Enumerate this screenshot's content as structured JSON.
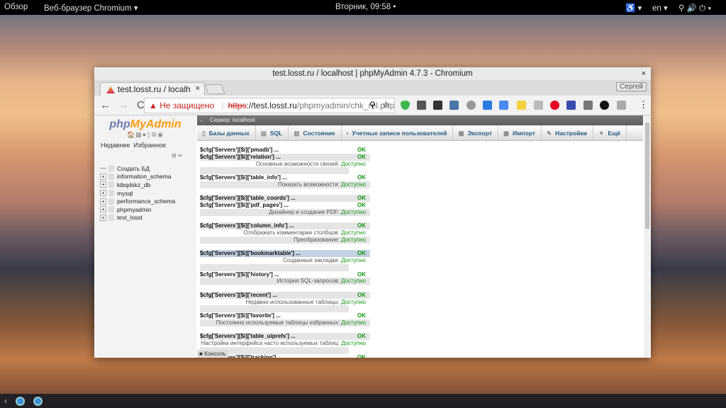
{
  "topbar": {
    "overview": "Обзор",
    "app": "Веб-браузер Chromium ▾",
    "clock": "Вторник, 09:58 •",
    "lang": "en ▾"
  },
  "window": {
    "title": "test.losst.ru / localhost | phpMyAdmin 4.7.3 - Chromium",
    "close": "×"
  },
  "tab": {
    "label": "test.losst.ru / localh",
    "close": "×"
  },
  "profile": "Сергей",
  "address": {
    "warning": "▲ Не защищено",
    "scheme": "https",
    "host": "://test.losst.ru",
    "path": "/phpmyadmin/chk_rel.php?c"
  },
  "sidebar": {
    "logo_a": "php",
    "logo_b": "MyAdmin",
    "recent": "Недавнее",
    "favorites": "Избранное",
    "new_db": "Создать БД",
    "dbs": [
      "information_schema",
      "kibqdskz_db",
      "mysql",
      "performance_schema",
      "phpmyadmin",
      "test_losst"
    ]
  },
  "server": "Сервер: localhost",
  "menu": [
    "Базы данных",
    "SQL",
    "Состояние",
    "Учетные записи пользователей",
    "Экспорт",
    "Импорт",
    "Настройки",
    "Ещё"
  ],
  "rows": [
    {
      "t": "cfg",
      "label": "$cfg['Servers'][$i]['pmadb'] ...",
      "status": "OK"
    },
    {
      "t": "cfg",
      "label": "$cfg['Servers'][$i]['relation'] ...",
      "status": "OK"
    },
    {
      "t": "feat",
      "label": "Основные возможности связей:",
      "status": "Доступно"
    },
    {
      "t": "empty"
    },
    {
      "t": "cfg",
      "label": "$cfg['Servers'][$i]['table_info'] ...",
      "status": "OK"
    },
    {
      "t": "feat",
      "label": "Показать возможности:",
      "status": "Доступно"
    },
    {
      "t": "empty"
    },
    {
      "t": "cfg",
      "label": "$cfg['Servers'][$i]['table_coords'] ...",
      "status": "OK"
    },
    {
      "t": "cfg",
      "label": "$cfg['Servers'][$i]['pdf_pages'] ...",
      "status": "OK"
    },
    {
      "t": "feat",
      "label": "Дизайнер и создание PDF:",
      "status": "Доступно"
    },
    {
      "t": "empty"
    },
    {
      "t": "cfg",
      "label": "$cfg['Servers'][$i]['column_info'] ...",
      "status": "OK"
    },
    {
      "t": "feat",
      "label": "Отображать комментарии столбцов:",
      "status": "Доступно"
    },
    {
      "t": "feat",
      "label": "Преобразование:",
      "status": "Доступно"
    },
    {
      "t": "empty"
    },
    {
      "t": "cfg",
      "label": "$cfg['Servers'][$i]['bookmarktable'] ...",
      "status": "OK",
      "hl": true
    },
    {
      "t": "feat",
      "label": "Созданные закладки:",
      "status": "Доступно"
    },
    {
      "t": "empty"
    },
    {
      "t": "cfg",
      "label": "$cfg['Servers'][$i]['history'] ...",
      "status": "OK"
    },
    {
      "t": "feat",
      "label": "История SQL-запросов:",
      "status": "Доступно"
    },
    {
      "t": "empty"
    },
    {
      "t": "cfg",
      "label": "$cfg['Servers'][$i]['recent'] ...",
      "status": "OK"
    },
    {
      "t": "feat",
      "label": "Недавно использованные таблицы:",
      "status": "Доступно"
    },
    {
      "t": "empty"
    },
    {
      "t": "cfg",
      "label": "$cfg['Servers'][$i]['favorite'] ...",
      "status": "OK"
    },
    {
      "t": "feat",
      "label": "Постоянно используемые таблицы избранных:",
      "status": "Доступно"
    },
    {
      "t": "empty"
    },
    {
      "t": "cfg",
      "label": "$cfg['Servers'][$i]['table_uiprefs'] ...",
      "status": "OK"
    },
    {
      "t": "feat",
      "label": "Настройки интерфейса часто используемых таблиц:",
      "status": "Доступно"
    },
    {
      "t": "empty"
    },
    {
      "t": "cfg",
      "label": "$cfg['Servers'][$i]['tracking'] ...",
      "status": "OK"
    }
  ],
  "console": "Консоль"
}
